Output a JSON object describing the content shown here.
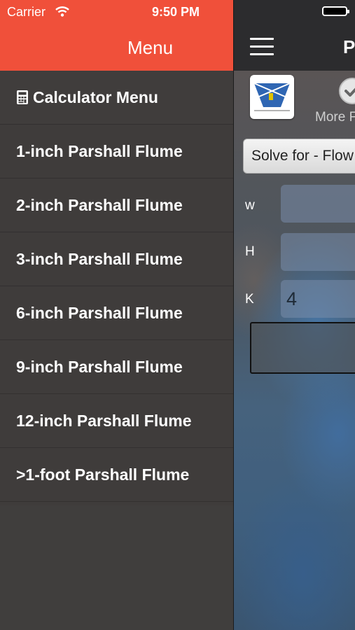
{
  "status_bar": {
    "carrier": "Carrier",
    "time": "9:50 PM"
  },
  "menu": {
    "title": "Menu",
    "items": [
      {
        "label": "Calculator Menu",
        "icon": "calculator-icon"
      },
      {
        "label": "1-inch Parshall Flume"
      },
      {
        "label": "2-inch Parshall Flume"
      },
      {
        "label": "3-inch Parshall Flume"
      },
      {
        "label": "6-inch Parshall Flume"
      },
      {
        "label": "9-inch Parshall Flume"
      },
      {
        "label": "12-inch Parshall Flume"
      },
      {
        "label": ">1-foot Parshall Flume"
      }
    ]
  },
  "main": {
    "title": "P",
    "more_label": "More F",
    "solve_button": "Solve for - Flow",
    "fields": [
      {
        "label": "w",
        "value": ""
      },
      {
        "label": "H",
        "value": ""
      },
      {
        "label": "K",
        "value": "4"
      }
    ]
  },
  "colors": {
    "header_accent": "#f0503a",
    "menu_bg": "#3f3c3b",
    "main_topbar": "#2c2c2e"
  }
}
